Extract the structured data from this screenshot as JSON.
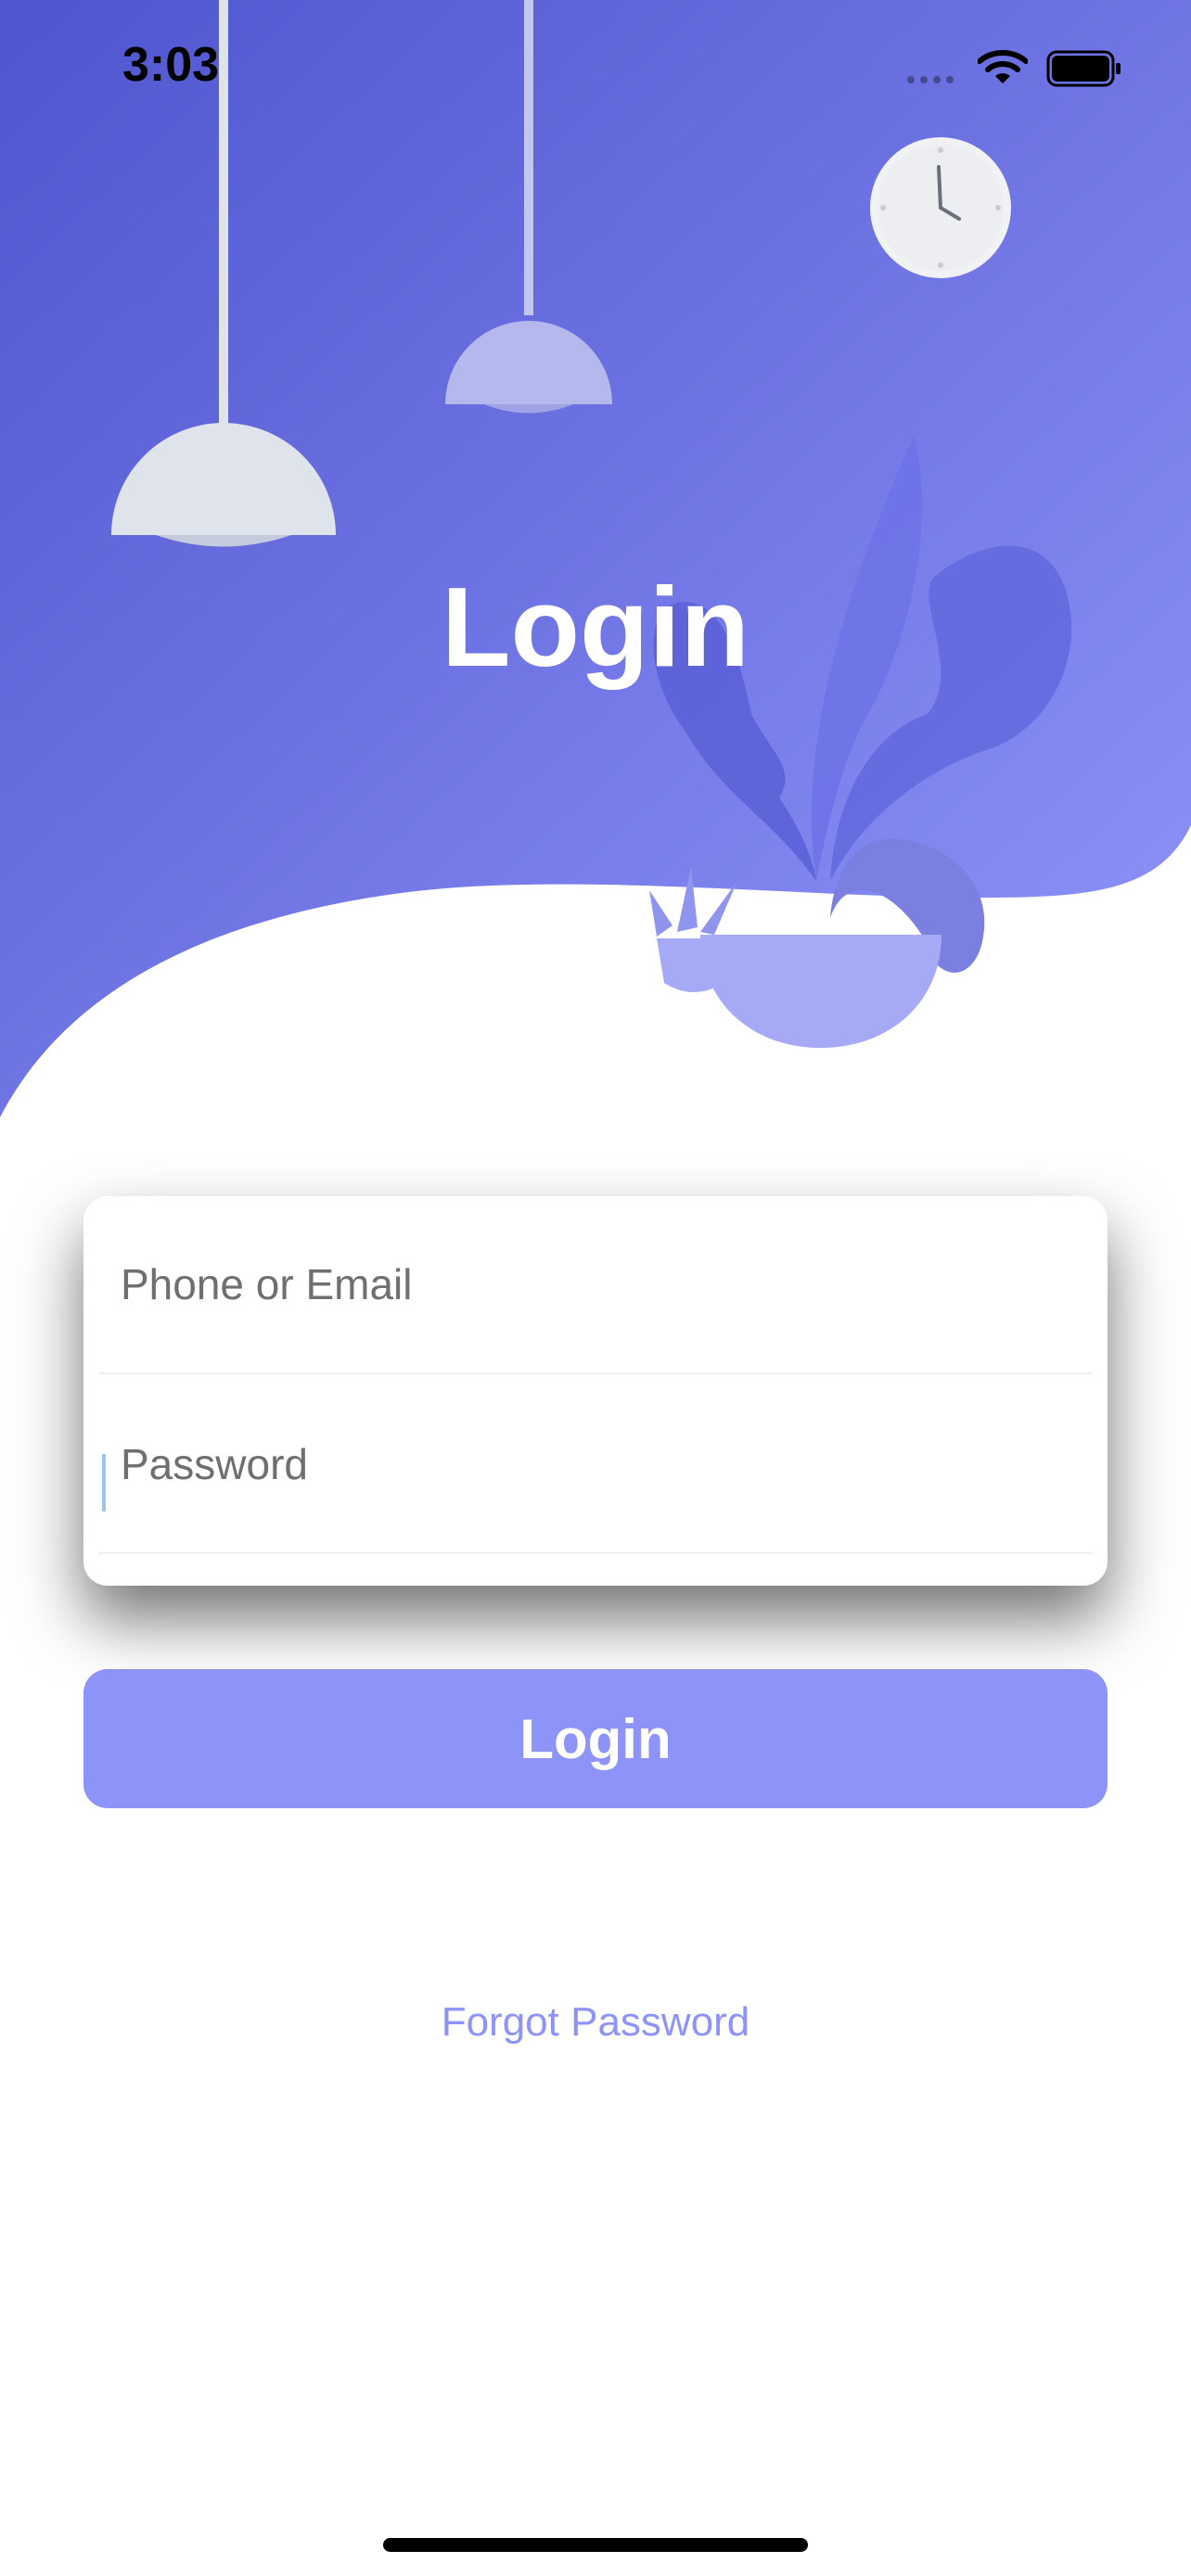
{
  "status_bar": {
    "time": "3:03",
    "icons": [
      "cellular-signal-icon",
      "wifi-icon",
      "battery-icon"
    ]
  },
  "header": {
    "title": "Login",
    "illustration": [
      "pendant-lamp-icon",
      "pendant-lamp-icon",
      "wall-clock-icon",
      "potted-plant-icon"
    ]
  },
  "form": {
    "phone_email": {
      "value": "",
      "placeholder": "Phone or Email"
    },
    "password": {
      "value": "",
      "placeholder": "Password"
    }
  },
  "actions": {
    "login_label": "Login",
    "forgot_password": "Forgot Password"
  },
  "colors": {
    "gradient_start": "#5058d0",
    "gradient_end": "#8e93f8",
    "accent": "#8e93f8",
    "lamp": "#dfe4ec",
    "plant": "#6d72e6",
    "pot": "#a6a9f5",
    "clock_face": "#f1f2f4"
  }
}
